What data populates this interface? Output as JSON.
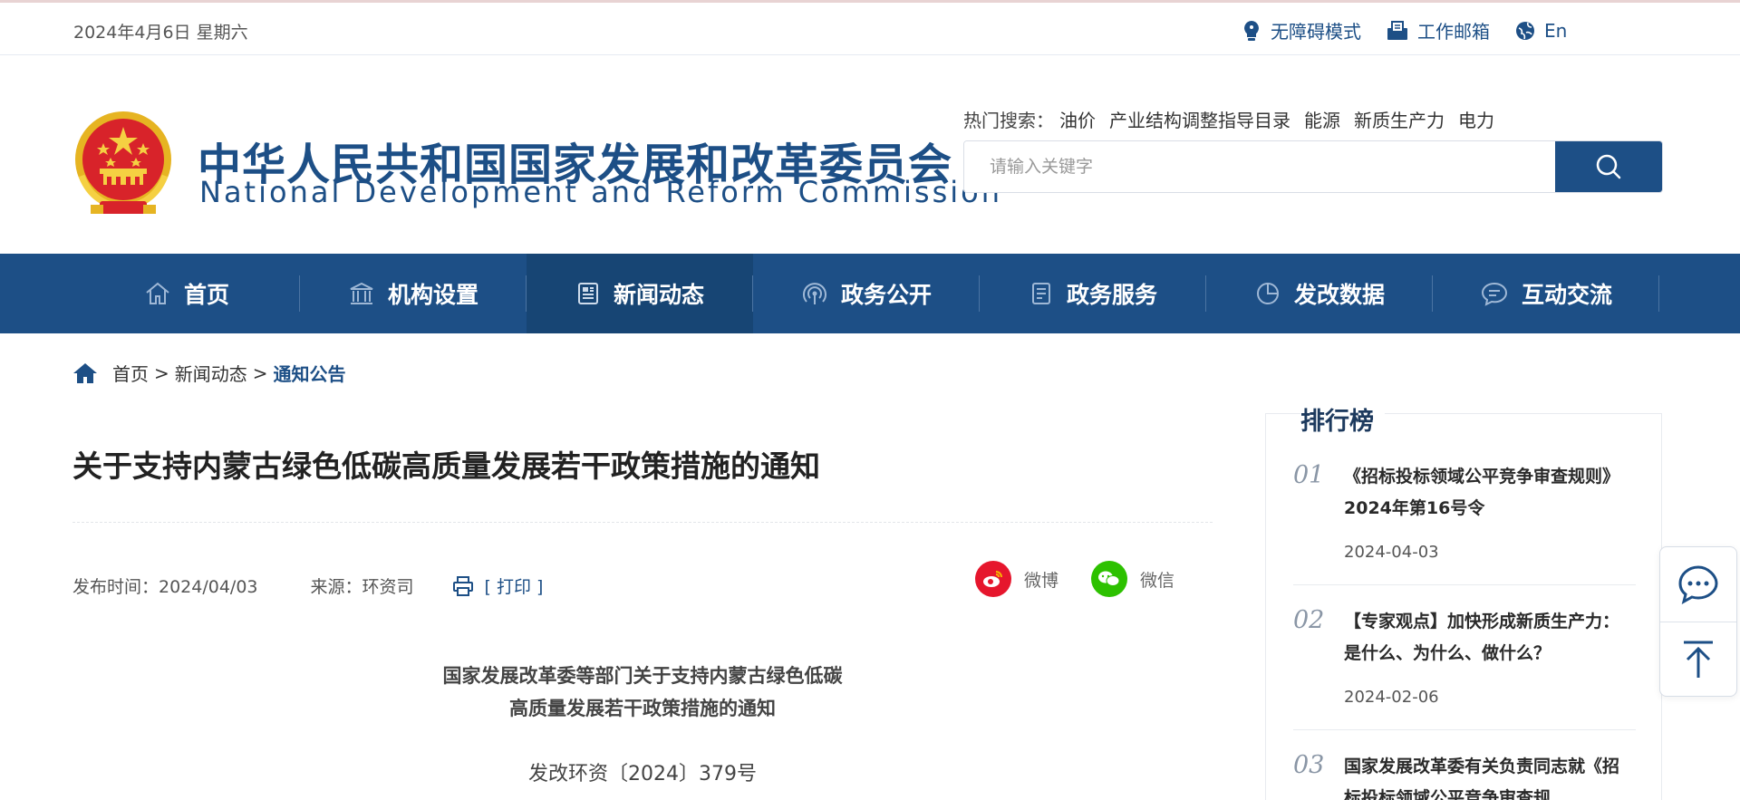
{
  "topbar": {
    "date": "2024年4月6日 星期六",
    "links": [
      {
        "label": "无障碍模式",
        "icon": "accessibility-icon"
      },
      {
        "label": "工作邮箱",
        "icon": "mailbox-icon"
      },
      {
        "label": "En",
        "icon": "globe-icon"
      }
    ]
  },
  "header": {
    "title_cn": "中华人民共和国国家发展和改革委员会",
    "title_en": "National Development and Reform Commission",
    "hot_label": "热门搜索：",
    "hot_items": [
      "油价",
      "产业结构调整指导目录",
      "能源",
      "新质生产力",
      "电力"
    ],
    "search_placeholder": "请输入关键字"
  },
  "nav": {
    "items": [
      {
        "label": "首页",
        "icon": "home-icon"
      },
      {
        "label": "机构设置",
        "icon": "institution-icon"
      },
      {
        "label": "新闻动态",
        "icon": "news-icon"
      },
      {
        "label": "政务公开",
        "icon": "broadcast-icon"
      },
      {
        "label": "政务服务",
        "icon": "service-icon"
      },
      {
        "label": "发改数据",
        "icon": "pie-chart-icon"
      },
      {
        "label": "互动交流",
        "icon": "chat-bubble-icon"
      }
    ],
    "active_index": 2
  },
  "breadcrumb": {
    "items": [
      "首页",
      "新闻动态"
    ],
    "separator": ">",
    "current": "通知公告"
  },
  "article": {
    "title": "关于支持内蒙古绿色低碳高质量发展若干政策措施的通知",
    "publish_time": "发布时间：2024/04/03",
    "source": "来源：环资司",
    "print_label": "[ 打印 ]",
    "share": [
      {
        "label": "微博",
        "icon": "weibo-icon",
        "color": "#e6162d"
      },
      {
        "label": "微信",
        "icon": "wechat-icon",
        "color": "#2dc100"
      }
    ],
    "doc_heading_line1": "国家发展改革委等部门关于支持内蒙古绿色低碳",
    "doc_heading_line2": "高质量发展若干政策措施的通知",
    "doc_number": "发改环资〔2024〕379号"
  },
  "ranking": {
    "title": "排行榜",
    "items": [
      {
        "num": "01",
        "title": "《招标投标领域公平竞争审查规则》 2024年第16号令",
        "date": "2024-04-03"
      },
      {
        "num": "02",
        "title": "【专家观点】加快形成新质生产力：是什么、为什么、做什么？",
        "date": "2024-02-06"
      },
      {
        "num": "03",
        "title": "国家发展改革委有关负责同志就《招标投标领域公平竞争审查规",
        "date": ""
      }
    ]
  },
  "colors": {
    "brand_blue": "#1d4f86",
    "nav_active": "#174574"
  }
}
